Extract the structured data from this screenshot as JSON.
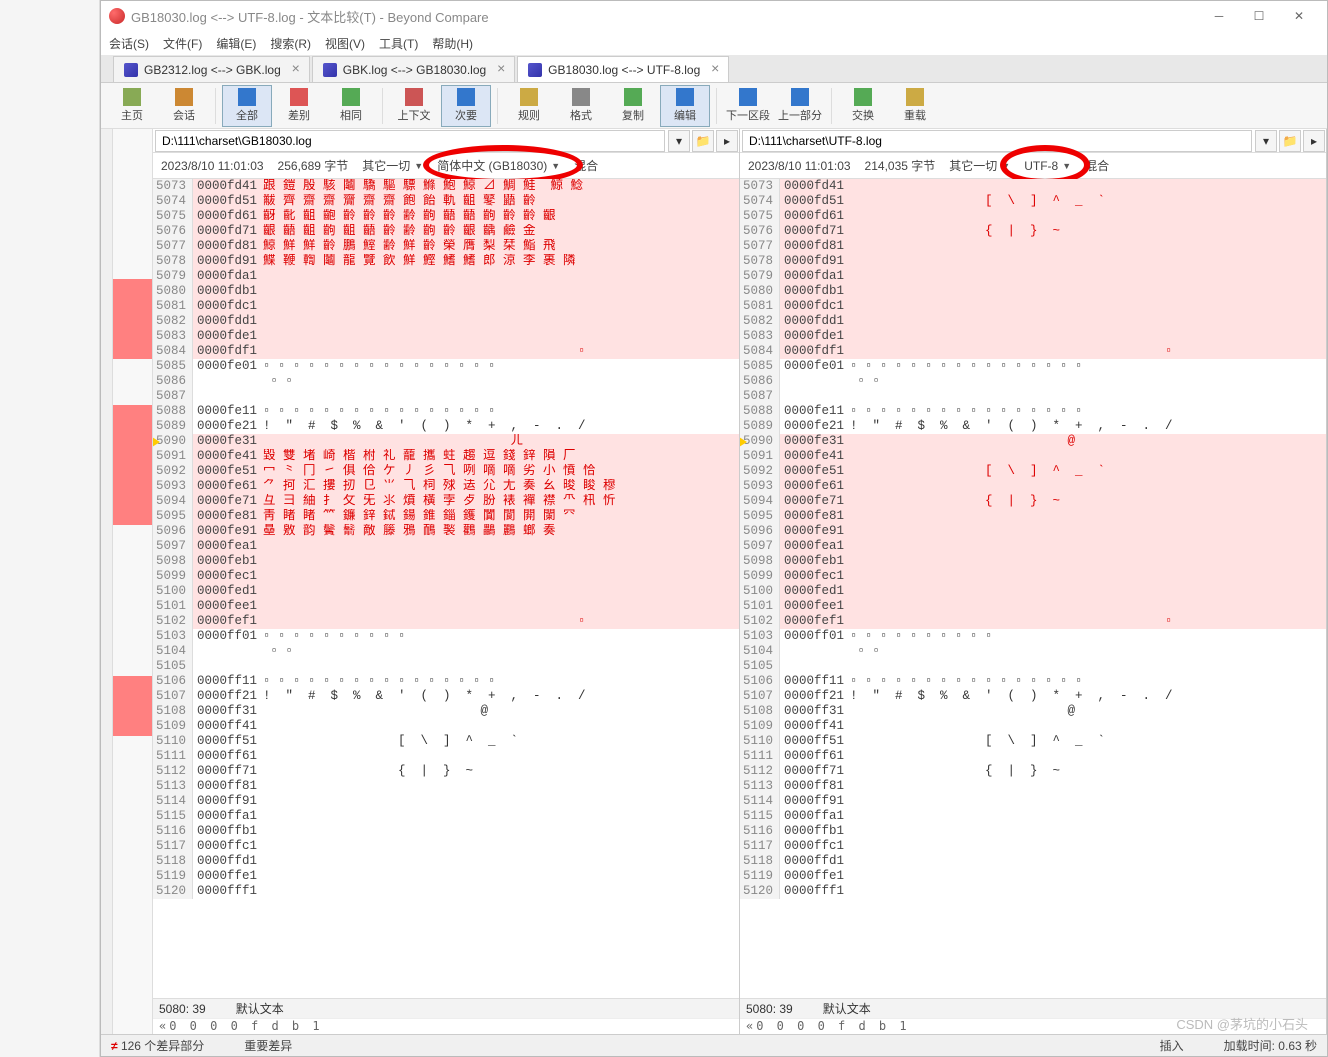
{
  "window": {
    "title": "GB18030.log <--> UTF-8.log - 文本比较(T) - Beyond Compare"
  },
  "menus": [
    "会话(S)",
    "文件(F)",
    "编辑(E)",
    "搜索(R)",
    "视图(V)",
    "工具(T)",
    "帮助(H)"
  ],
  "tabs": [
    {
      "label": "GB2312.log <--> GBK.log",
      "active": false
    },
    {
      "label": "GBK.log <--> GB18030.log",
      "active": false
    },
    {
      "label": "GB18030.log <--> UTF-8.log",
      "active": true
    }
  ],
  "toolbar": [
    {
      "label": "主页",
      "icon": "home"
    },
    {
      "label": "会话",
      "icon": "session"
    },
    {
      "sep": true
    },
    {
      "label": "全部",
      "icon": "all",
      "active": true
    },
    {
      "label": "差别",
      "icon": "diff"
    },
    {
      "label": "相同",
      "icon": "same"
    },
    {
      "sep": true
    },
    {
      "label": "上下文",
      "icon": "context"
    },
    {
      "label": "次要",
      "icon": "minor",
      "active": true
    },
    {
      "sep": true
    },
    {
      "label": "规则",
      "icon": "rules"
    },
    {
      "label": "格式",
      "icon": "format"
    },
    {
      "label": "复制",
      "icon": "copy"
    },
    {
      "label": "编辑",
      "icon": "edit",
      "active": true
    },
    {
      "sep": true
    },
    {
      "label": "下一区段",
      "icon": "next"
    },
    {
      "label": "上一部分",
      "icon": "prev"
    },
    {
      "sep": true
    },
    {
      "label": "交换",
      "icon": "swap"
    },
    {
      "label": "重载",
      "icon": "reload"
    }
  ],
  "left": {
    "path": "D:\\111\\charset\\GB18030.log",
    "timestamp": "2023/8/10 11:01:03",
    "size": "256,689 字节",
    "filter": "其它一切",
    "encoding": "简体中文 (GB18030)",
    "mix": "混合",
    "bottom_pos": "5080: 39",
    "bottom_label": "默认文本",
    "hex_detail": "«0 0 0 0 f d b 1"
  },
  "right": {
    "path": "D:\\111\\charset\\UTF-8.log",
    "timestamp": "2023/8/10 11:01:03",
    "size": "214,035 字节",
    "filter": "其它一切",
    "encoding": "UTF-8",
    "mix": "混合",
    "bottom_pos": "5080: 39",
    "bottom_label": "默认文本",
    "hex_detail": "«0 0 0 0 f d b 1"
  },
  "lines_left": [
    {
      "n": 5073,
      "a": "0000fd41",
      "t": "跟 鎧 殷 駭 鬮 驕 驅 驃 鰷 鮑 鯨 ⊿ 鯛 鮭  鯨 鯰",
      "d": true
    },
    {
      "n": 5074,
      "a": "0000fd51",
      "t": "黻 齊 齋 齋 齎 齋 齋 飽 飴 軌 齟 鼕 鼯 齡",
      "d": true
    },
    {
      "n": 5075,
      "a": "0000fd61",
      "t": "齖 齔 齟 齙 齡 齡 齡 齢 齣 齬 齬 齣 齡 齡 齦",
      "d": true
    },
    {
      "n": 5076,
      "a": "0000fd71",
      "t": "齦 齬 齟 齣 齟 齬 齡 齢 齣 齡 齦 齲 鹼 金",
      "d": true
    },
    {
      "n": 5077,
      "a": "0000fd81",
      "t": "鯨 鮮 鮮 齡 鵬 鰘 齢 鮮 齡 榮 膺 梨 栞 鮨 飛",
      "d": true
    },
    {
      "n": 5078,
      "a": "0000fd91",
      "t": "鰈 鞭 輷 鬮 龍 覽 飲 鮮 鰹 鰭 鰭 郎 涼 李 裹 隣",
      "d": true
    },
    {
      "n": 5079,
      "a": "0000fda1",
      "t": "",
      "d": true
    },
    {
      "n": 5080,
      "a": "0000fdb1",
      "t": "",
      "d": true
    },
    {
      "n": 5081,
      "a": "0000fdc1",
      "t": "",
      "d": true
    },
    {
      "n": 5082,
      "a": "0000fdd1",
      "t": "",
      "d": true
    },
    {
      "n": 5083,
      "a": "0000fde1",
      "t": "",
      "d": true
    },
    {
      "n": 5084,
      "a": "0000fdf1",
      "t": "                                          ▫",
      "d": true
    },
    {
      "n": 5085,
      "a": "0000fe01",
      "t": "▫ ▫ ▫ ▫ ▫ ▫ ▫ ▫ ▫ ▫ ▫ ▫ ▫ ▫ ▫ ▫",
      "d": false
    },
    {
      "n": 5086,
      "a": "",
      "t": " ▫ ▫",
      "d": false
    },
    {
      "n": 5087,
      "a": "",
      "t": "",
      "d": false
    },
    {
      "n": 5088,
      "a": "0000fe11",
      "t": "▫ ▫ ▫ ▫ ▫ ▫ ▫ ▫ ▫ ▫ ▫ ▫ ▫ ▫ ▫ ▫",
      "d": false
    },
    {
      "n": 5089,
      "a": "0000fe21",
      "t": "!  \"  #  $  %  &  '  (  )  *  +  ,  -  .  /",
      "d": false
    },
    {
      "n": 5090,
      "a": "0000fe31",
      "t": "                                 ㄦ",
      "d": true,
      "arrow": true
    },
    {
      "n": 5091,
      "a": "0000fe41",
      "t": "毀 雙 堵 崎 楷 柎 礼 蘢 攜 蛀 趨 逗 錢 鋅 隕 厂",
      "d": true
    },
    {
      "n": 5092,
      "a": "0000fe51",
      "t": "冖 ⺀ 冂 ㇀ 俱 佮 ケ ㇓ 彡 ⺄ 咧 嘀 嘀 劣 小 憤 恰",
      "d": true
    },
    {
      "n": 5093,
      "a": "0000fe61",
      "t": "⺈ 抲 汇 摟 扨 ⺋ ⺌ ⺄ 柌 殏 迲 ⺏ ⺐ 奏 ⺓ 晙 睃 穆",
      "d": true
    },
    {
      "n": 5094,
      "a": "0000fe71",
      "t": "⺔ ⺕ 紬 ⺘ ⺙ ⺛ ⺢ 燌 橫 孛 ⺞ 朌 裱 襌 襟 ⺥ 㭄 忻",
      "d": true
    },
    {
      "n": 5095,
      "a": "0000fe81",
      "t": "靑 睹 睹 ⺮ 鐮 鋅 鋱 鍚 錐 錙 鑊 闐 閬 閞 闌 ⺳",
      "d": true
    },
    {
      "n": 5096,
      "a": "0000fe91",
      "t": "皨 敫 韵 鬢 鬋 敵 籐 鴉 鴯 褧 鸛 鸓 鸝 螂 奏",
      "d": true
    },
    {
      "n": 5097,
      "a": "0000fea1",
      "t": "",
      "d": true
    },
    {
      "n": 5098,
      "a": "0000feb1",
      "t": "",
      "d": true
    },
    {
      "n": 5099,
      "a": "0000fec1",
      "t": "",
      "d": true
    },
    {
      "n": 5100,
      "a": "0000fed1",
      "t": "",
      "d": true
    },
    {
      "n": 5101,
      "a": "0000fee1",
      "t": "",
      "d": true
    },
    {
      "n": 5102,
      "a": "0000fef1",
      "t": "                                          ▫",
      "d": true
    },
    {
      "n": 5103,
      "a": "0000ff01",
      "t": "▫ ▫ ▫ ▫ ▫ ▫ ▫ ▫ ▫ ▫",
      "d": false
    },
    {
      "n": 5104,
      "a": "",
      "t": " ▫ ▫",
      "d": false
    },
    {
      "n": 5105,
      "a": "",
      "t": "",
      "d": false
    },
    {
      "n": 5106,
      "a": "0000ff11",
      "t": "▫ ▫ ▫ ▫ ▫ ▫ ▫ ▫ ▫ ▫ ▫ ▫ ▫ ▫ ▫ ▫",
      "d": false
    },
    {
      "n": 5107,
      "a": "0000ff21",
      "t": "!  \"  #  $  %  &  '  (  )  *  +  ,  -  .  /",
      "d": false
    },
    {
      "n": 5108,
      "a": "0000ff31",
      "t": "                             @",
      "d": false
    },
    {
      "n": 5109,
      "a": "0000ff41",
      "t": "",
      "d": false
    },
    {
      "n": 5110,
      "a": "0000ff51",
      "t": "                  [  \\  ]  ^  _  `",
      "d": false
    },
    {
      "n": 5111,
      "a": "0000ff61",
      "t": "",
      "d": false
    },
    {
      "n": 5112,
      "a": "0000ff71",
      "t": "                  {  |  }  ~",
      "d": false
    },
    {
      "n": 5113,
      "a": "0000ff81",
      "t": "",
      "d": false
    },
    {
      "n": 5114,
      "a": "0000ff91",
      "t": "",
      "d": false
    },
    {
      "n": 5115,
      "a": "0000ffa1",
      "t": "",
      "d": false
    },
    {
      "n": 5116,
      "a": "0000ffb1",
      "t": "",
      "d": false
    },
    {
      "n": 5117,
      "a": "0000ffc1",
      "t": "",
      "d": false
    },
    {
      "n": 5118,
      "a": "0000ffd1",
      "t": "",
      "d": false
    },
    {
      "n": 5119,
      "a": "0000ffe1",
      "t": "",
      "d": false
    },
    {
      "n": 5120,
      "a": "0000fff1",
      "t": "",
      "d": false
    }
  ],
  "lines_right": [
    {
      "n": 5073,
      "a": "0000fd41",
      "t": "",
      "d": true
    },
    {
      "n": 5074,
      "a": "0000fd51",
      "t": "                  [  \\  ]  ^  _  `",
      "d": true
    },
    {
      "n": 5075,
      "a": "0000fd61",
      "t": "",
      "d": true
    },
    {
      "n": 5076,
      "a": "0000fd71",
      "t": "                  {  |  }  ~",
      "d": true
    },
    {
      "n": 5077,
      "a": "0000fd81",
      "t": "",
      "d": true
    },
    {
      "n": 5078,
      "a": "0000fd91",
      "t": "",
      "d": true
    },
    {
      "n": 5079,
      "a": "0000fda1",
      "t": "",
      "d": true
    },
    {
      "n": 5080,
      "a": "0000fdb1",
      "t": "",
      "d": true
    },
    {
      "n": 5081,
      "a": "0000fdc1",
      "t": "",
      "d": true
    },
    {
      "n": 5082,
      "a": "0000fdd1",
      "t": "",
      "d": true
    },
    {
      "n": 5083,
      "a": "0000fde1",
      "t": "",
      "d": true
    },
    {
      "n": 5084,
      "a": "0000fdf1",
      "t": "                                          ▫",
      "d": true
    },
    {
      "n": 5085,
      "a": "0000fe01",
      "t": "▫ ▫ ▫ ▫ ▫ ▫ ▫ ▫ ▫ ▫ ▫ ▫ ▫ ▫ ▫ ▫",
      "d": false
    },
    {
      "n": 5086,
      "a": "",
      "t": " ▫ ▫",
      "d": false
    },
    {
      "n": 5087,
      "a": "",
      "t": "",
      "d": false
    },
    {
      "n": 5088,
      "a": "0000fe11",
      "t": "▫ ▫ ▫ ▫ ▫ ▫ ▫ ▫ ▫ ▫ ▫ ▫ ▫ ▫ ▫ ▫",
      "d": false
    },
    {
      "n": 5089,
      "a": "0000fe21",
      "t": "!  \"  #  $  %  &  '  (  )  *  +  ,  -  .  /",
      "d": false
    },
    {
      "n": 5090,
      "a": "0000fe31",
      "t": "                             @",
      "d": true,
      "arrow": true
    },
    {
      "n": 5091,
      "a": "0000fe41",
      "t": "",
      "d": true
    },
    {
      "n": 5092,
      "a": "0000fe51",
      "t": "                  [  \\  ]  ^  _  `",
      "d": true
    },
    {
      "n": 5093,
      "a": "0000fe61",
      "t": "",
      "d": true
    },
    {
      "n": 5094,
      "a": "0000fe71",
      "t": "                  {  |  }  ~",
      "d": true
    },
    {
      "n": 5095,
      "a": "0000fe81",
      "t": "",
      "d": true
    },
    {
      "n": 5096,
      "a": "0000fe91",
      "t": "",
      "d": true
    },
    {
      "n": 5097,
      "a": "0000fea1",
      "t": "",
      "d": true
    },
    {
      "n": 5098,
      "a": "0000feb1",
      "t": "",
      "d": true
    },
    {
      "n": 5099,
      "a": "0000fec1",
      "t": "",
      "d": true
    },
    {
      "n": 5100,
      "a": "0000fed1",
      "t": "",
      "d": true
    },
    {
      "n": 5101,
      "a": "0000fee1",
      "t": "",
      "d": true
    },
    {
      "n": 5102,
      "a": "0000fef1",
      "t": "                                          ▫",
      "d": true
    },
    {
      "n": 5103,
      "a": "0000ff01",
      "t": "▫ ▫ ▫ ▫ ▫ ▫ ▫ ▫ ▫ ▫",
      "d": false
    },
    {
      "n": 5104,
      "a": "",
      "t": " ▫ ▫",
      "d": false
    },
    {
      "n": 5105,
      "a": "",
      "t": "",
      "d": false
    },
    {
      "n": 5106,
      "a": "0000ff11",
      "t": "▫ ▫ ▫ ▫ ▫ ▫ ▫ ▫ ▫ ▫ ▫ ▫ ▫ ▫ ▫ ▫",
      "d": false
    },
    {
      "n": 5107,
      "a": "0000ff21",
      "t": "!  \"  #  $  %  &  '  (  )  *  +  ,  -  .  /",
      "d": false
    },
    {
      "n": 5108,
      "a": "0000ff31",
      "t": "                             @",
      "d": false
    },
    {
      "n": 5109,
      "a": "0000ff41",
      "t": "",
      "d": false
    },
    {
      "n": 5110,
      "a": "0000ff51",
      "t": "                  [  \\  ]  ^  _  `",
      "d": false
    },
    {
      "n": 5111,
      "a": "0000ff61",
      "t": "",
      "d": false
    },
    {
      "n": 5112,
      "a": "0000ff71",
      "t": "                  {  |  }  ~",
      "d": false
    },
    {
      "n": 5113,
      "a": "0000ff81",
      "t": "",
      "d": false
    },
    {
      "n": 5114,
      "a": "0000ff91",
      "t": "",
      "d": false
    },
    {
      "n": 5115,
      "a": "0000ffa1",
      "t": "",
      "d": false
    },
    {
      "n": 5116,
      "a": "0000ffb1",
      "t": "",
      "d": false
    },
    {
      "n": 5117,
      "a": "0000ffc1",
      "t": "",
      "d": false
    },
    {
      "n": 5118,
      "a": "0000ffd1",
      "t": "",
      "d": false
    },
    {
      "n": 5119,
      "a": "0000ffe1",
      "t": "",
      "d": false
    },
    {
      "n": 5120,
      "a": "0000fff1",
      "t": "",
      "d": false
    }
  ],
  "status": {
    "diff_count": "126 个差异部分",
    "important": "重要差异",
    "mode": "插入",
    "load": "加载时间: 0.63 秒"
  },
  "watermark": "CSDN @茅坑的小石头"
}
